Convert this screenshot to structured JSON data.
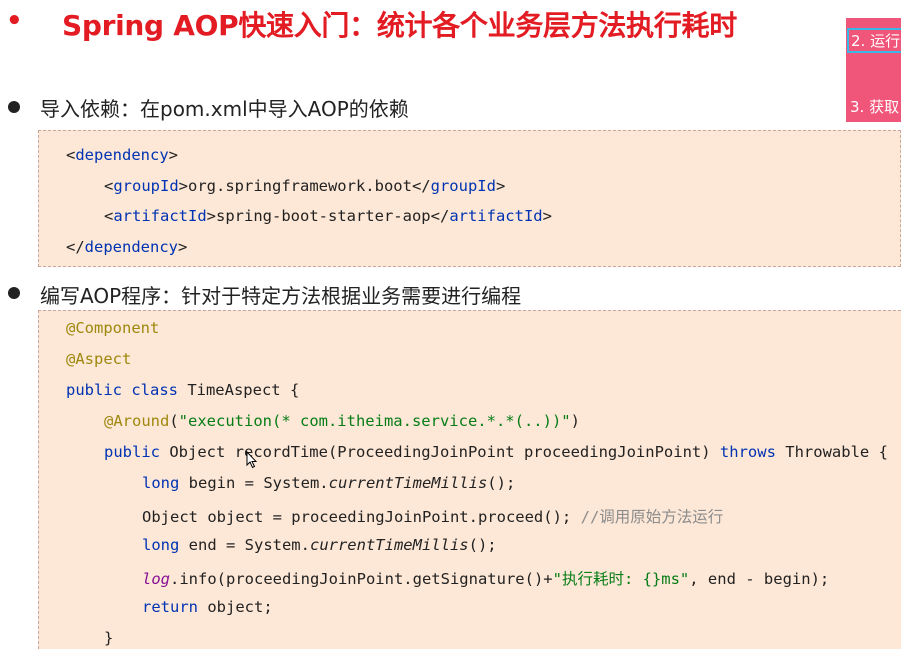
{
  "title": {
    "bullet": "•",
    "text": "Spring AOP快速入门：统计各个业务层方法执行耗时"
  },
  "side_panel": {
    "item1": "2. 运行",
    "item2": "3. 获取"
  },
  "section1": {
    "heading": "导入依赖：在pom.xml中导入AOP的依赖",
    "code": {
      "l1_open": "<",
      "l1_tag": "dependency",
      "l1_close": ">",
      "l2_open": "<",
      "l2_tag": "groupId",
      "l2_text": ">org.springframework.boot</",
      "l2_tag2": "groupId",
      "l2_close": ">",
      "l3_open": "<",
      "l3_tag": "artifactId",
      "l3_text": ">spring-boot-starter-aop</",
      "l3_tag2": "artifactId",
      "l3_close": ">",
      "l4_open": "</",
      "l4_tag": "dependency",
      "l4_close": ">"
    }
  },
  "section2": {
    "heading": "编写AOP程序：针对于特定方法根据业务需要进行编程",
    "code": {
      "l1": "@Component",
      "l2": "@Aspect",
      "l3_kw": "public class",
      "l3_rest": " TimeAspect {",
      "l4_ann": "@Around",
      "l4_p1": "(",
      "l4_str": "\"execution(* com.itheima.service.*.*(..))\"",
      "l4_p2": ")",
      "l5_kw": "public",
      "l5_mid": " Object recordTime(ProceedingJoinPoint proceedingJoinPoint) ",
      "l5_kw2": "throws",
      "l5_end": " Throwable {",
      "l6_kw": "long",
      "l6_mid": " begin = System.",
      "l6_it": "currentTimeMillis",
      "l6_end": "();",
      "l7_code": "Object object = proceedingJoinPoint.proceed(); ",
      "l7_cmt": "//调用原始方法运行",
      "l8_kw": "long",
      "l8_mid": " end = System.",
      "l8_it": "currentTimeMillis",
      "l8_end": "();",
      "l9_fld": "log",
      "l9_mid": ".info(proceedingJoinPoint.getSignature()+",
      "l9_str": "\"执行耗时: {}ms\"",
      "l9_end": ", end - begin);",
      "l10_kw": "return",
      "l10_rest": " object;",
      "l11": "}"
    }
  },
  "icons": {
    "cursor": "mouse-pointer-icon"
  },
  "colors": {
    "title": "#e31b23",
    "side_panel": "#f0557a",
    "code_bg": "#fde7d6",
    "keyword": "#0033b3",
    "annotation": "#9e880d",
    "string": "#067d17",
    "comment": "#8c8c8c"
  }
}
